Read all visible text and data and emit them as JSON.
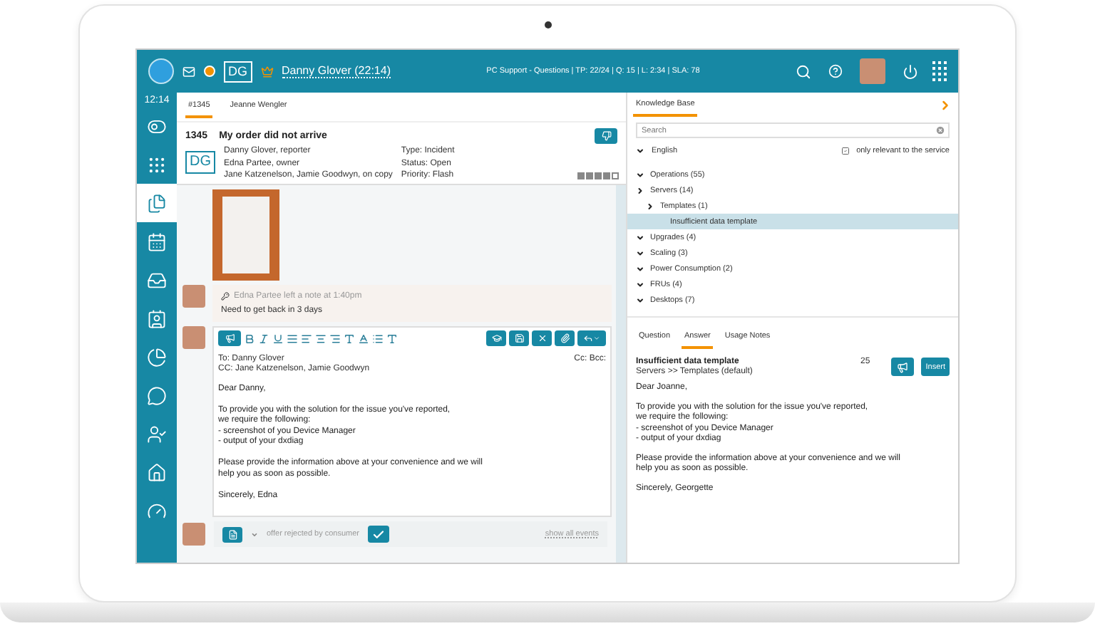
{
  "top_bar": {
    "initials": "DG",
    "customer": "Danny Glover (22:14)",
    "stats": "PC Support - Questions | TP: 22/24 | Q: 15 | L: 2:34 | SLA: 78"
  },
  "sidebar": {
    "time": "12:14",
    "items": [
      {
        "kind": "toggle",
        "selected": false
      },
      {
        "kind": "grid",
        "selected": false
      },
      {
        "kind": "tickets",
        "selected": true
      },
      {
        "kind": "calendar",
        "selected": false
      },
      {
        "kind": "inbox",
        "selected": false
      },
      {
        "kind": "contacts",
        "selected": false
      },
      {
        "kind": "reports",
        "selected": false
      },
      {
        "kind": "chat",
        "selected": false
      },
      {
        "kind": "users",
        "selected": false
      },
      {
        "kind": "home",
        "selected": false
      },
      {
        "kind": "dashboard",
        "selected": false
      }
    ]
  },
  "ticket_tabs": [
    {
      "label": "#1345",
      "selected": true
    },
    {
      "label": "Jeanne Wengler",
      "selected": false
    }
  ],
  "ticket": {
    "number": "1345",
    "subject": "My order did not arrive",
    "initials": "DG",
    "people": [
      "Danny Glover, reporter",
      "Edna Partee, owner",
      "Jane Katzenelson, Jamie Goodwyn, on copy"
    ],
    "meta": [
      "Type: Incident",
      "Status: Open",
      "Priority: Flash"
    ],
    "priority_meter": {
      "stars": 4
    }
  },
  "note": {
    "header": "Edna Partee left a note at 1:40pm",
    "text": "Need to get back in 3 days"
  },
  "reply": {
    "to": "To: Danny Glover",
    "cc": "CC: Jane Katzenelson, Jamie Goodwyn",
    "cc_bcc": "Cc: Bcc:",
    "body": [
      "Dear Danny,",
      "To provide you with the solution for the issue you've reported,\nwe require the following:\n- screenshot of you Device Manager\n- output of your dxdiag",
      "Please provide the information above at your convenience and we will\nhelp you as soon as possible.",
      "Sincerely, Edna"
    ]
  },
  "footer": {
    "status": "offer rejected by consumer",
    "link": "show all events"
  },
  "knowledge_base": {
    "tab": "Knowledge Base",
    "search": {
      "placeholder": "Search"
    },
    "language": "English",
    "filter": {
      "label": "only relevant to the service",
      "checked": true
    },
    "tree": [
      {
        "label": "Operations (55)",
        "expanded": true,
        "selected": false
      },
      {
        "label": "Servers (14)",
        "expanded": false,
        "selected": false,
        "children": [
          {
            "label": "Templates (1)",
            "expanded": false,
            "selected": false,
            "children": [
              {
                "label": "Insufficient data template",
                "selected": true
              }
            ]
          }
        ]
      },
      {
        "label": "Upgrades (4)",
        "expanded": true,
        "selected": false
      },
      {
        "label": "Scaling (3)",
        "expanded": true,
        "selected": false
      },
      {
        "label": "Power Consumption (2)",
        "expanded": true,
        "selected": false
      },
      {
        "label": "FRUs (4)",
        "expanded": true,
        "selected": false
      },
      {
        "label": "Desktops (7)",
        "expanded": true,
        "selected": false
      }
    ],
    "answer_tabs": [
      {
        "label": "Question",
        "selected": false
      },
      {
        "label": "Answer",
        "selected": true
      },
      {
        "label": "Usage Notes",
        "selected": false
      }
    ],
    "article": {
      "title": "Insufficient data template",
      "path": "Servers >> Templates (default)",
      "count": "25",
      "insert": "Insert",
      "body": [
        "Dear Joanne,",
        "To provide you with the solution for the issue you've reported,\nwe require the following:\n- screenshot of you Device Manager\n- output of your dxdiag",
        "Please provide the information above at your convenience and we will\nhelp you as soon as possible.",
        "Sincerely, Georgette"
      ]
    }
  }
}
